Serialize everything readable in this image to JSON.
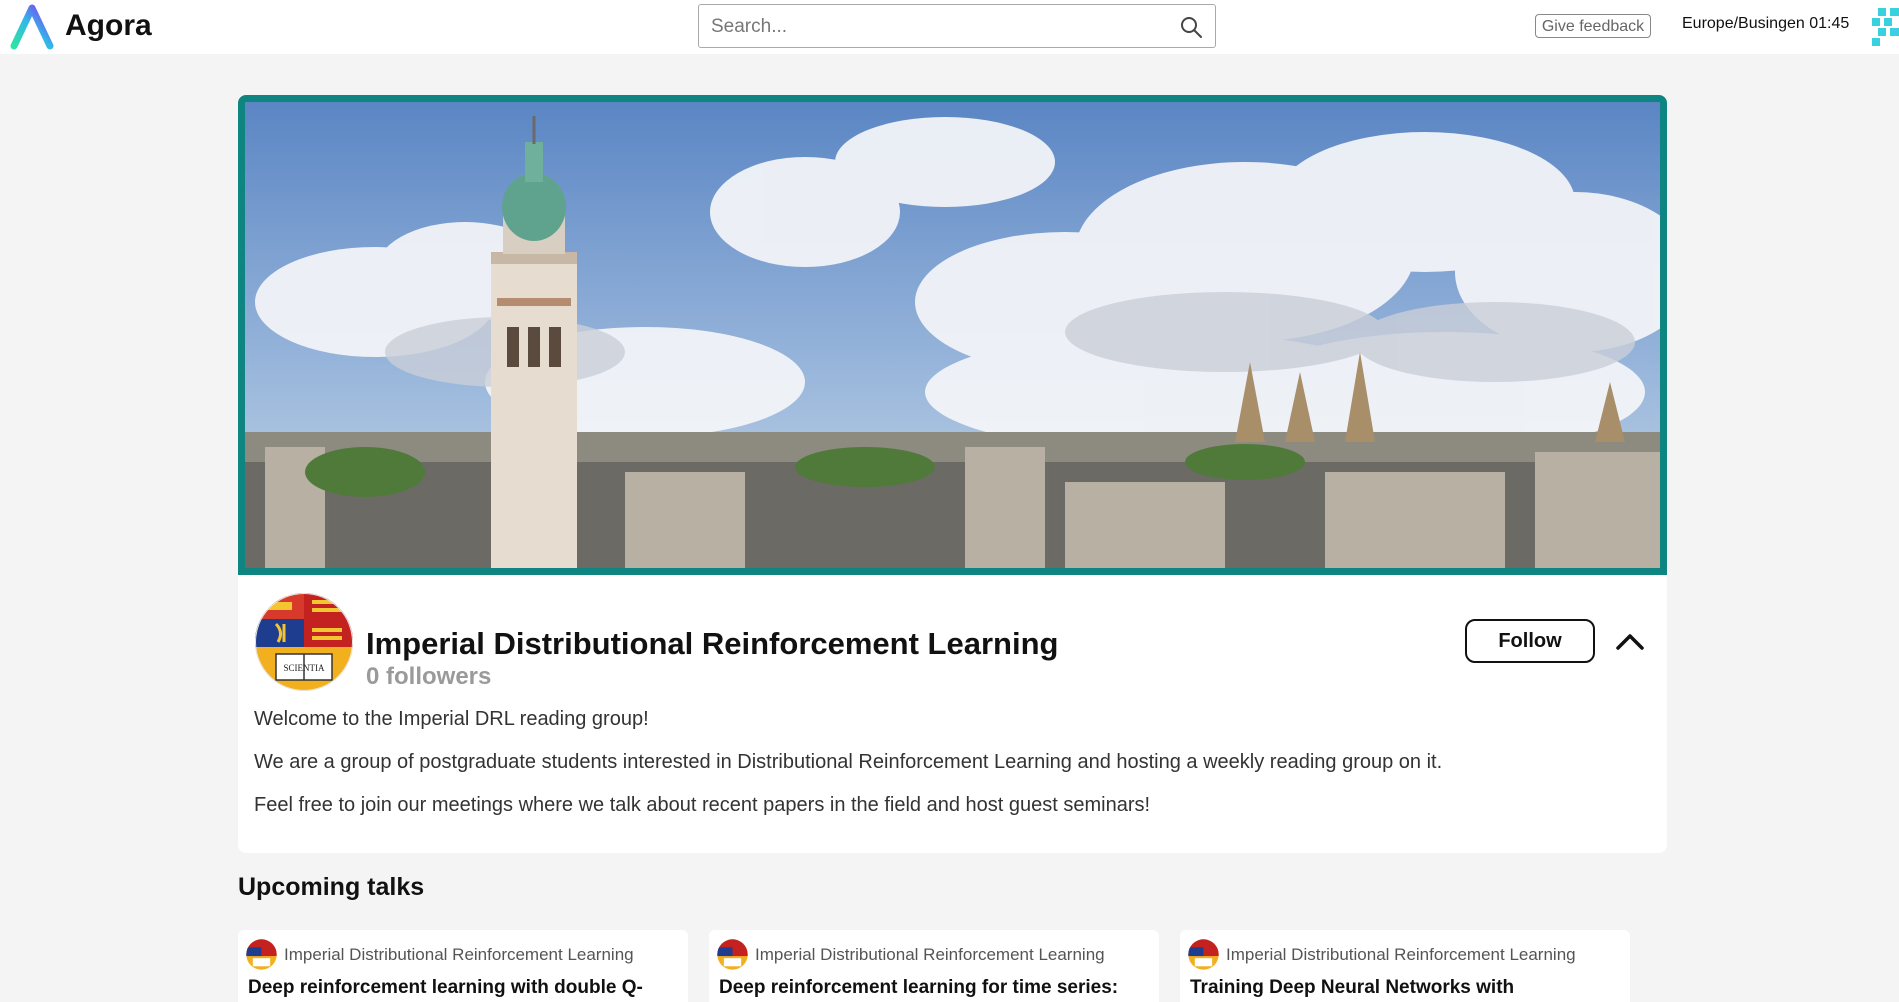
{
  "app": {
    "name": "Agora"
  },
  "header": {
    "search_placeholder": "Search...",
    "feedback_label": "Give feedback",
    "timezone_clock": "Europe/Busingen 01:45"
  },
  "group": {
    "name": "Imperial Distributional Reinforcement Learning",
    "followers": "0 followers",
    "follow_label": "Follow",
    "logo_motto": "SCIENTIA",
    "description": [
      "Welcome to the Imperial DRL reading group!",
      "We are a group of postgraduate students interested in Distributional Reinforcement Learning and hosting a weekly reading group on it.",
      "Feel free to join our meetings where we talk about recent papers in the field and host guest seminars!"
    ]
  },
  "upcoming": {
    "title": "Upcoming talks",
    "talks": [
      {
        "group": "Imperial Distributional Reinforcement Learning",
        "title": "Deep reinforcement learning with double Q-learning"
      },
      {
        "group": "Imperial Distributional Reinforcement Learning",
        "title": "Deep reinforcement learning for time series: playing idealized trading games"
      },
      {
        "group": "Imperial Distributional Reinforcement Learning",
        "title": "Training Deep Neural Networks with Reinforcement Learning for Time Series"
      }
    ]
  },
  "colors": {
    "banner_border": "#0e8580",
    "brand_gradient_start": "#2ee3a4",
    "brand_gradient_end": "#8b2cf5",
    "followers_text": "#9a9a9a"
  },
  "icons": {
    "search": "search-icon",
    "collapse": "chevron-up-icon",
    "brand": "agora-logo"
  }
}
